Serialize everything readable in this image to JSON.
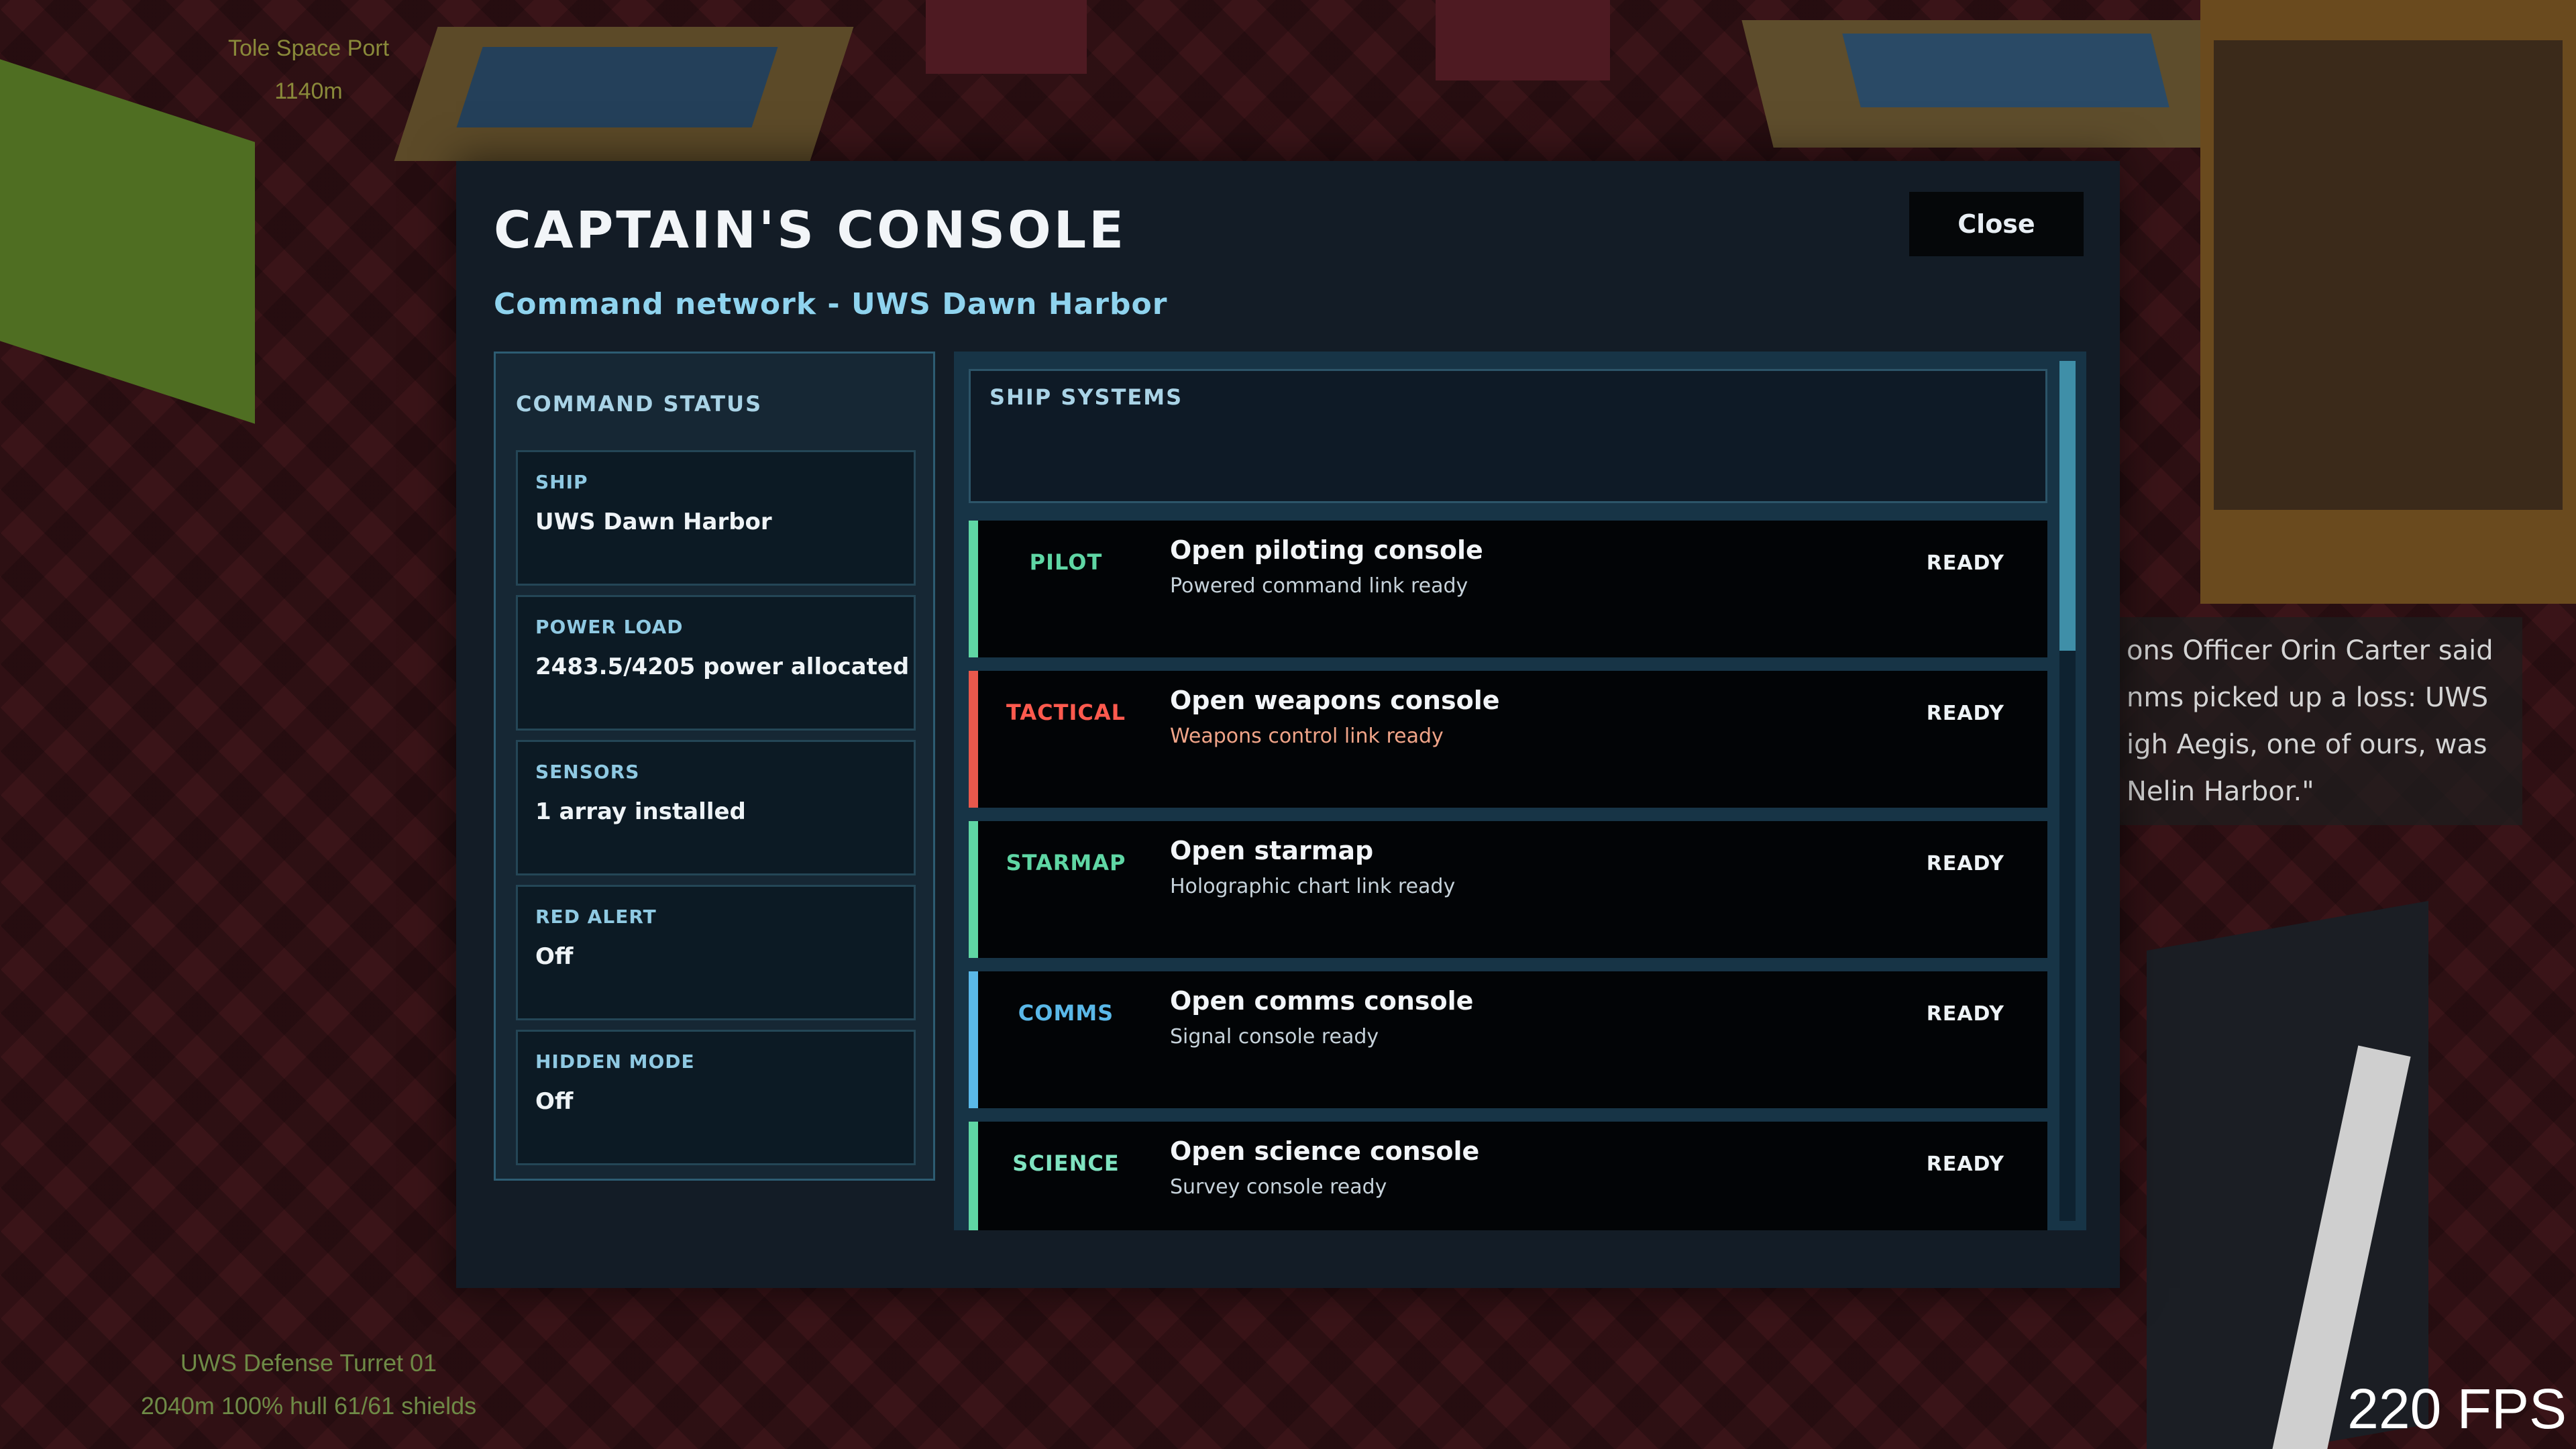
{
  "world": {
    "top_marker_name": "Tole Space Port",
    "top_marker_distance": "1140m",
    "bottom_marker_name": "UWS Defense Turret 01",
    "bottom_marker_stats": "2040m  100% hull  61/61 shields",
    "dialogue": "ons Officer Orin Carter said\nnms picked up a loss: UWS\nigh Aegis, one of ours, was\n Nelin Harbor.\"",
    "fps": "220 FPS"
  },
  "console": {
    "title": "CAPTAIN'S CONSOLE",
    "close_label": "Close",
    "subtitle": "Command network - UWS Dawn Harbor"
  },
  "status": {
    "heading": "COMMAND STATUS",
    "cards": [
      {
        "label": "SHIP",
        "value": "UWS Dawn Harbor"
      },
      {
        "label": "POWER LOAD",
        "value": "2483.5/4205 power allocated"
      },
      {
        "label": "SENSORS",
        "value": "1 array installed"
      },
      {
        "label": "RED ALERT",
        "value": "Off"
      },
      {
        "label": "HIDDEN MODE",
        "value": "Off"
      }
    ]
  },
  "systems": {
    "heading": "SHIP SYSTEMS",
    "scroll_position": 0.0,
    "items": [
      {
        "tag": "PILOT",
        "title": "Open piloting console",
        "desc": "Powered command link ready",
        "state": "READY",
        "accent": "#5fd6a4",
        "tag_color": "#5fd6a4",
        "desc_color": "#c6d2da"
      },
      {
        "tag": "TACTICAL",
        "title": "Open weapons console",
        "desc": "Weapons control link ready",
        "state": "READY",
        "accent": "#e8584c",
        "tag_color": "#ff5a4e",
        "desc_color": "#f0a488"
      },
      {
        "tag": "STARMAP",
        "title": "Open starmap",
        "desc": "Holographic chart link ready",
        "state": "READY",
        "accent": "#5fd6a4",
        "tag_color": "#5fd6a4",
        "desc_color": "#c6d2da"
      },
      {
        "tag": "COMMS",
        "title": "Open comms console",
        "desc": "Signal console ready",
        "state": "READY",
        "accent": "#5ab8e8",
        "tag_color": "#5ab8e8",
        "desc_color": "#c6d2da"
      },
      {
        "tag": "SCIENCE",
        "title": "Open science console",
        "desc": "Survey console ready",
        "state": "READY",
        "accent": "#5fd6a4",
        "tag_color": "#7fe3c0",
        "desc_color": "#c6d2da"
      }
    ]
  }
}
